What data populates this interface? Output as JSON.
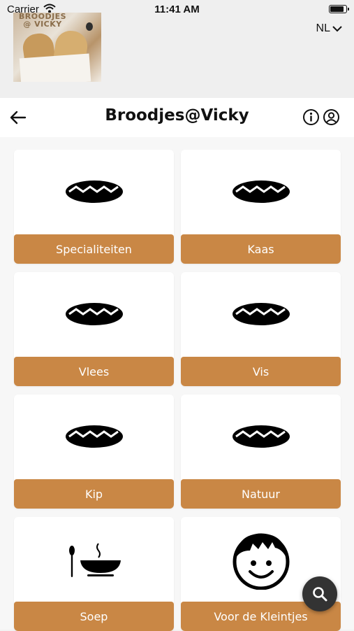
{
  "status_bar": {
    "carrier": "Carrier",
    "time": "11:41 AM"
  },
  "logo_text": "BROODJES @ VICKY",
  "language": {
    "selected": "NL"
  },
  "header": {
    "title": "Broodjes@Vicky"
  },
  "categories": [
    {
      "label": "Specialiteiten",
      "icon": "sandwich-icon"
    },
    {
      "label": "Kaas",
      "icon": "sandwich-icon"
    },
    {
      "label": "Vlees",
      "icon": "sandwich-icon"
    },
    {
      "label": "Vis",
      "icon": "sandwich-icon"
    },
    {
      "label": "Kip",
      "icon": "sandwich-icon"
    },
    {
      "label": "Natuur",
      "icon": "sandwich-icon"
    },
    {
      "label": "Soep",
      "icon": "soup-icon"
    },
    {
      "label": "Voor de Kleintjes",
      "icon": "kid-face-icon"
    }
  ],
  "colors": {
    "accent": "#c98745",
    "fab": "#333333"
  }
}
